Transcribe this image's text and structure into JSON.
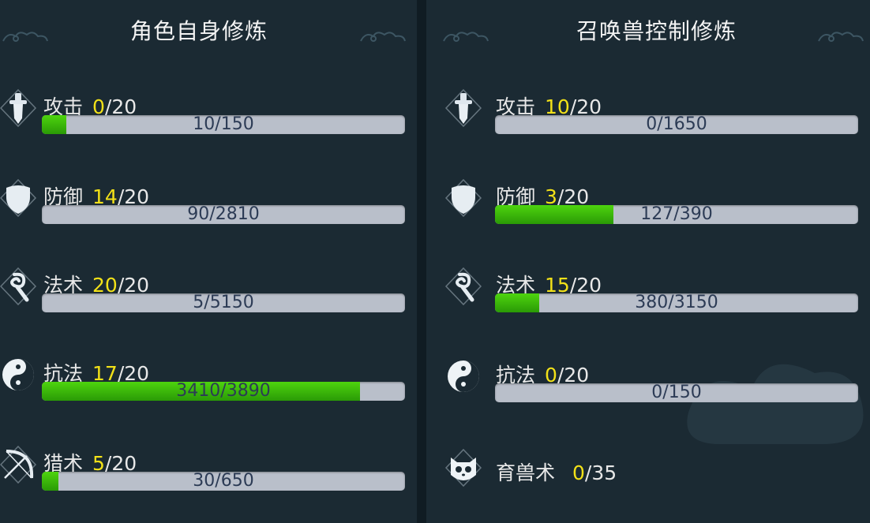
{
  "left": {
    "title": "角色自身修炼",
    "rows": [
      {
        "icon": "sword-icon",
        "name": "攻击",
        "level": "0",
        "max": "/20",
        "progress": "10/150",
        "fill": 0.067
      },
      {
        "icon": "shield-icon",
        "name": "防御",
        "level": "14",
        "max": "/20",
        "progress": "90/2810",
        "fill": 0.0
      },
      {
        "icon": "staff-icon",
        "name": "法术",
        "level": "20",
        "max": "/20",
        "progress": "5/5150",
        "fill": 0.0
      },
      {
        "icon": "yin-yang-icon",
        "name": "抗法",
        "level": "17",
        "max": "/20",
        "progress": "3410/3890",
        "fill": 0.877
      },
      {
        "icon": "bow-icon",
        "name": "猎术",
        "level": "5",
        "max": "/20",
        "progress": "30/650",
        "fill": 0.046
      }
    ]
  },
  "right": {
    "title": "召唤兽控制修炼",
    "rows": [
      {
        "icon": "sword-icon",
        "name": "攻击",
        "level": "10",
        "max": "/20",
        "progress": "0/1650",
        "fill": 0.0
      },
      {
        "icon": "shield-icon",
        "name": "防御",
        "level": "3",
        "max": "/20",
        "progress": "127/390",
        "fill": 0.326
      },
      {
        "icon": "staff-icon",
        "name": "法术",
        "level": "15",
        "max": "/20",
        "progress": "380/3150",
        "fill": 0.121
      },
      {
        "icon": "yin-yang-icon",
        "name": "抗法",
        "level": "0",
        "max": "/20",
        "progress": "0/150",
        "fill": 0.0
      }
    ],
    "extra": {
      "icon": "pet-cat-icon",
      "name": "育兽术",
      "level": "0",
      "max": "/35"
    }
  },
  "colors": {
    "fill": "#3cc00a",
    "level": "#f2e118",
    "bar": "#b9bfca",
    "background": "#1b2a33"
  }
}
